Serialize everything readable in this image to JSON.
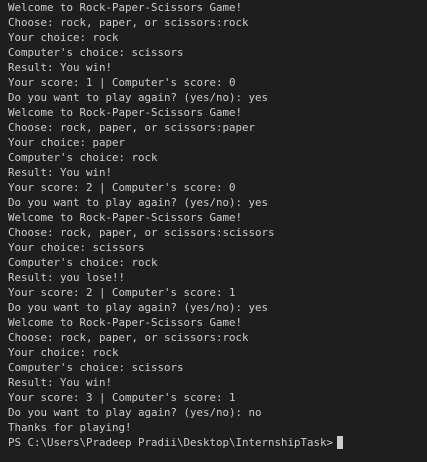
{
  "terminal": {
    "lines": [
      "Welcome to Rock-Paper-Scissors Game!",
      "Choose: rock, paper, or scissors:rock",
      "Your choice: rock",
      "Computer's choice: scissors",
      "Result: You win!",
      "Your score: 1 | Computer's score: 0",
      "Do you want to play again? (yes/no): yes",
      "Welcome to Rock-Paper-Scissors Game!",
      "Choose: rock, paper, or scissors:paper",
      "Your choice: paper",
      "Computer's choice: rock",
      "Result: You win!",
      "Your score: 2 | Computer's score: 0",
      "Do you want to play again? (yes/no): yes",
      "Welcome to Rock-Paper-Scissors Game!",
      "Choose: rock, paper, or scissors:scissors",
      "Your choice: scissors",
      "Computer's choice: rock",
      "Result: you lose!!",
      "Your score: 2 | Computer's score: 1",
      "Do you want to play again? (yes/no): yes",
      "Welcome to Rock-Paper-Scissors Game!",
      "Choose: rock, paper, or scissors:rock",
      "Your choice: rock",
      "Computer's choice: scissors",
      "Result: You win!",
      "Your score: 3 | Computer's score: 1",
      "Do you want to play again? (yes/no): no",
      "Thanks for playing!"
    ],
    "prompt": "PS C:\\Users\\Pradeep Pradii\\Desktop\\InternshipTask>",
    "colors": {
      "background": "#1e1e1e",
      "text": "#cccccc"
    }
  }
}
